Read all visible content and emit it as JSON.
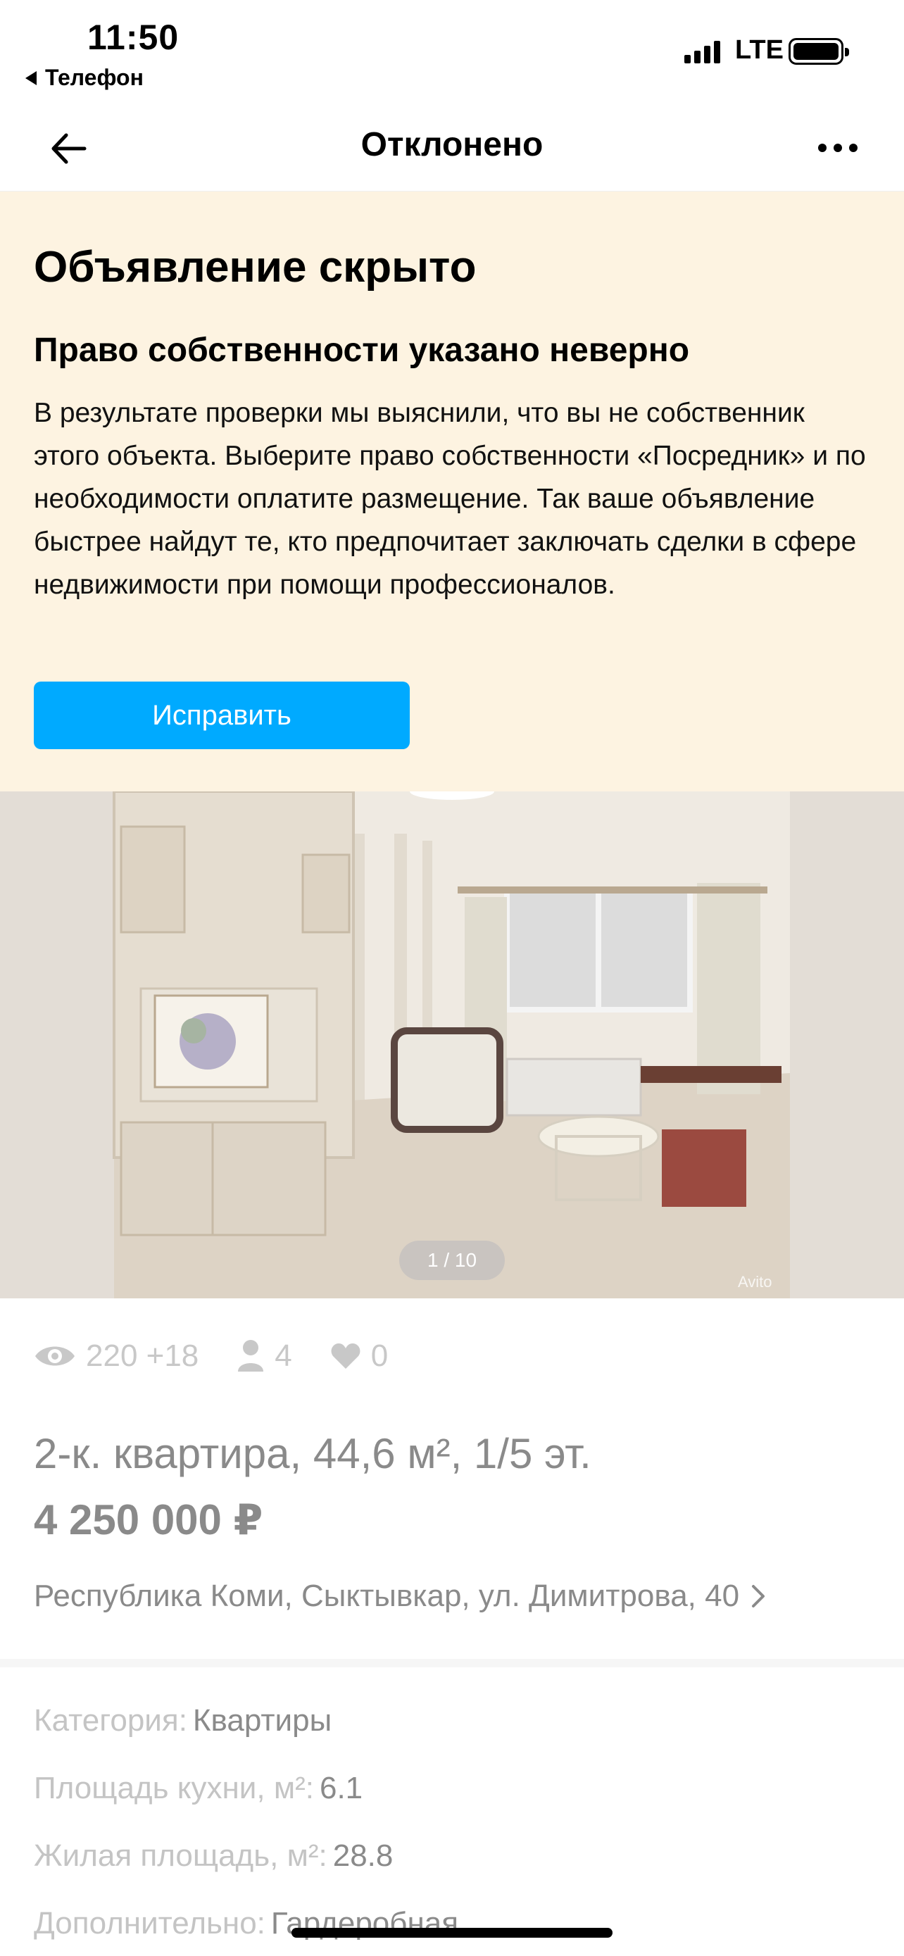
{
  "status_bar": {
    "time": "11:50",
    "back_app": "Телефон",
    "network": "LTE"
  },
  "nav": {
    "title": "Отклонено"
  },
  "banner": {
    "heading": "Объявление скрыто",
    "subheading": "Право собственности указано неверно",
    "text": "В результате проверки мы выяснили, что вы не собственник этого объекта. Выберите право собственности «Посредник» и по необходимости оплатите размещение. Так ваше объявление быстрее найдут те, кто предпочитает заключать сделки в сфере недвижимости при помощи профессионалов.",
    "button_label": "Исправить",
    "background_color": "#fdf3e1",
    "button_color": "#00aaff"
  },
  "photo": {
    "counter": "1 / 10",
    "watermark": "Avito"
  },
  "stats": {
    "views": "220 +18",
    "contacts": "4",
    "favorites": "0"
  },
  "listing": {
    "title": "2-к. квартира, 44,6 м², 1/5 эт.",
    "price": "4 250 000 ₽",
    "address": "Республика Коми, Сыктывкар, ул. Димитрова, 40"
  },
  "params": [
    {
      "label": "Категория:",
      "value": "Квартиры"
    },
    {
      "label": "Площадь кухни, м²:",
      "value": "6.1"
    },
    {
      "label": "Жилая площадь, м²:",
      "value": "28.8"
    },
    {
      "label": "Дополнительно:",
      "value": "Гардеробная"
    }
  ],
  "icons": {
    "back": "arrow-left-icon",
    "more": "more-dots-icon",
    "views": "eye-icon",
    "contacts": "person-icon",
    "favorites": "heart-icon",
    "address": "chevron-right-icon"
  }
}
